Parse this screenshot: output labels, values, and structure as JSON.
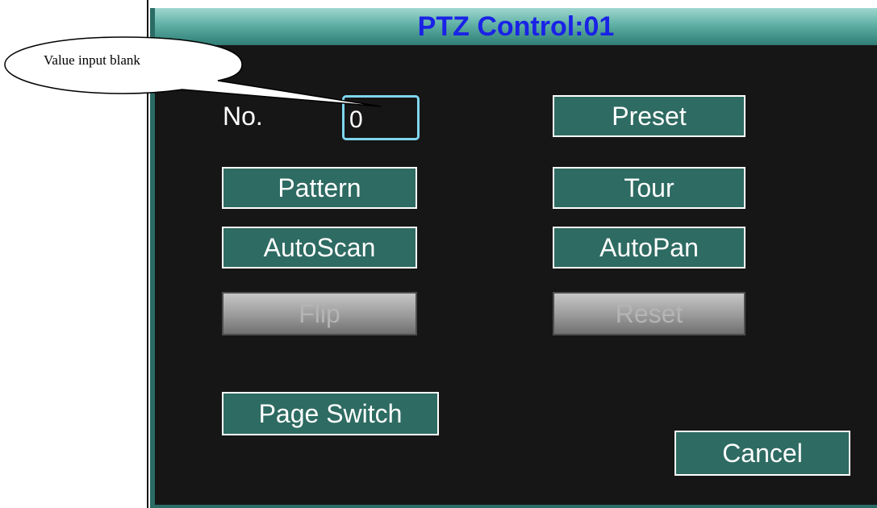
{
  "window": {
    "title": "PTZ Control:01"
  },
  "callout": {
    "text": "Value input blank"
  },
  "fields": {
    "no_label": "No.",
    "no_value": "0"
  },
  "buttons": {
    "preset": "Preset",
    "pattern": "Pattern",
    "tour": "Tour",
    "autoscan": "AutoScan",
    "autopan": "AutoPan",
    "flip": "Flip",
    "reset": "Reset",
    "page_switch": "Page Switch",
    "cancel": "Cancel"
  },
  "colors": {
    "title_text": "#1a22e6",
    "button_fill": "#2e6b62",
    "input_border": "#7fd6ee",
    "panel_bg": "#161616"
  }
}
